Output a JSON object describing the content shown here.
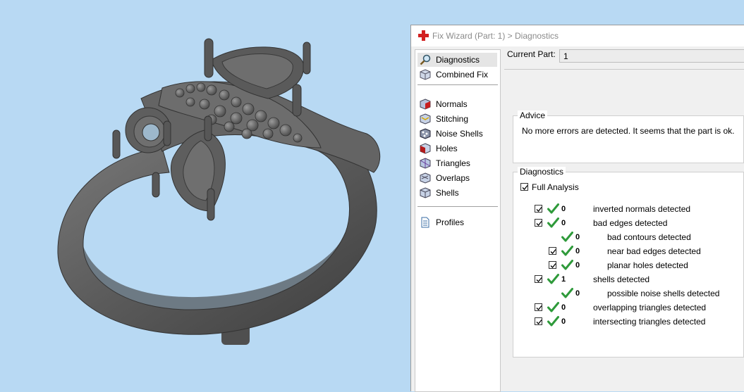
{
  "window": {
    "title": "Fix Wizard (Part: 1) > Diagnostics",
    "title_icon": "red-cross-icon"
  },
  "sidebar": {
    "items_top": [
      {
        "label": "Diagnostics",
        "icon": "magnifier-icon",
        "selected": true
      },
      {
        "label": "Combined Fix",
        "icon": "cube-icon",
        "selected": false
      }
    ],
    "items_mid": [
      {
        "label": "Normals",
        "icon": "normals-cube-icon"
      },
      {
        "label": "Stitching",
        "icon": "stitching-cube-icon"
      },
      {
        "label": "Noise Shells",
        "icon": "noise-shells-icon"
      },
      {
        "label": "Holes",
        "icon": "holes-cube-icon"
      },
      {
        "label": "Triangles",
        "icon": "triangles-cube-icon"
      },
      {
        "label": "Overlaps",
        "icon": "overlaps-cube-icon"
      },
      {
        "label": "Shells",
        "icon": "shells-cube-icon"
      }
    ],
    "items_bottom": [
      {
        "label": "Profiles",
        "icon": "document-icon"
      }
    ]
  },
  "current_part": {
    "label": "Current Part:",
    "value": "1"
  },
  "advice": {
    "title": "Advice",
    "text": "No more errors are detected. It seems that the part is ok."
  },
  "diagnostics": {
    "title": "Diagnostics",
    "full_analysis": {
      "label": "Full Analysis",
      "checked": true
    },
    "rows": [
      {
        "count": "0",
        "label": "inverted normals detected",
        "checkbox": true,
        "indent": 0
      },
      {
        "count": "0",
        "label": "bad edges detected",
        "checkbox": true,
        "indent": 0
      },
      {
        "count": "0",
        "label": "bad contours detected",
        "checkbox": false,
        "indent": 1
      },
      {
        "count": "0",
        "label": "near bad edges detected",
        "checkbox": true,
        "indent": 1
      },
      {
        "count": "0",
        "label": "planar holes detected",
        "checkbox": true,
        "indent": 1
      },
      {
        "count": "1",
        "label": "shells detected",
        "checkbox": true,
        "indent": 0
      },
      {
        "count": "0",
        "label": "possible noise shells detected",
        "checkbox": false,
        "indent": 1
      },
      {
        "count": "0",
        "label": "overlapping triangles detected",
        "checkbox": true,
        "indent": 0
      },
      {
        "count": "0",
        "label": "intersecting triangles detected",
        "checkbox": true,
        "indent": 0
      }
    ]
  },
  "colors": {
    "viewport_bg": "#b8d9f3",
    "model": "#5e5e5e",
    "check_green": "#2e9a3a"
  }
}
